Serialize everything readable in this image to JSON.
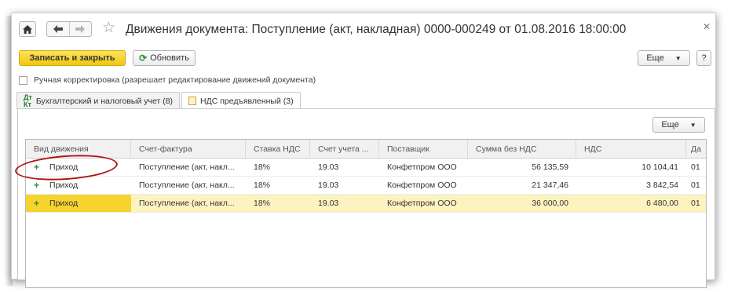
{
  "window": {
    "title": "Движения документа: Поступление (акт, накладная) 0000-000249 от 01.08.2016 18:00:00",
    "icons": {
      "home": "home-icon",
      "back": "arrow-left-icon",
      "forward": "arrow-right-icon",
      "favorite": "star-icon",
      "close": "close-icon"
    }
  },
  "toolbar": {
    "save_close_label": "Записать и закрыть",
    "refresh_label": "Обновить",
    "more_label": "Еще",
    "help_label": "?"
  },
  "manual_edit": {
    "label": "Ручная корректировка (разрешает редактирование движений документа)",
    "checked": false
  },
  "tabs": [
    {
      "label": "Бухгалтерский и налоговый учет (8)",
      "icon": "accounting-icon",
      "active": false
    },
    {
      "label": "НДС предъявленный (3)",
      "icon": "document-icon",
      "active": true
    }
  ],
  "panel": {
    "more_label": "Еще"
  },
  "table": {
    "columns": [
      "Вид движения",
      "Счет-фактура",
      "Ставка НДС",
      "Счет учета ...",
      "Поставщик",
      "Сумма без НДС",
      "НДС",
      "Да"
    ],
    "rows": [
      {
        "type_icon": "+",
        "type": "Приход",
        "invoice": "Поступление (акт, накл...",
        "rate": "18%",
        "account": "19.03",
        "supplier": "Конфетпром ООО",
        "sum": "56 135,59",
        "vat": "10 104,41",
        "date": "01",
        "selected": false
      },
      {
        "type_icon": "+",
        "type": "Приход",
        "invoice": "Поступление (акт, накл...",
        "rate": "18%",
        "account": "19.03",
        "supplier": "Конфетпром ООО",
        "sum": "21 347,46",
        "vat": "3 842,54",
        "date": "01",
        "selected": false
      },
      {
        "type_icon": "+",
        "type": "Приход",
        "invoice": "Поступление (акт, накл...",
        "rate": "18%",
        "account": "19.03",
        "supplier": "Конфетпром ООО",
        "sum": "36 000,00",
        "vat": "6 480,00",
        "date": "01",
        "selected": true
      }
    ]
  },
  "colors": {
    "accent_yellow": "#f2c713",
    "selected_row": "#fcf3c0",
    "annotation_red": "#b01515",
    "plus_green": "#2d8c2d"
  }
}
